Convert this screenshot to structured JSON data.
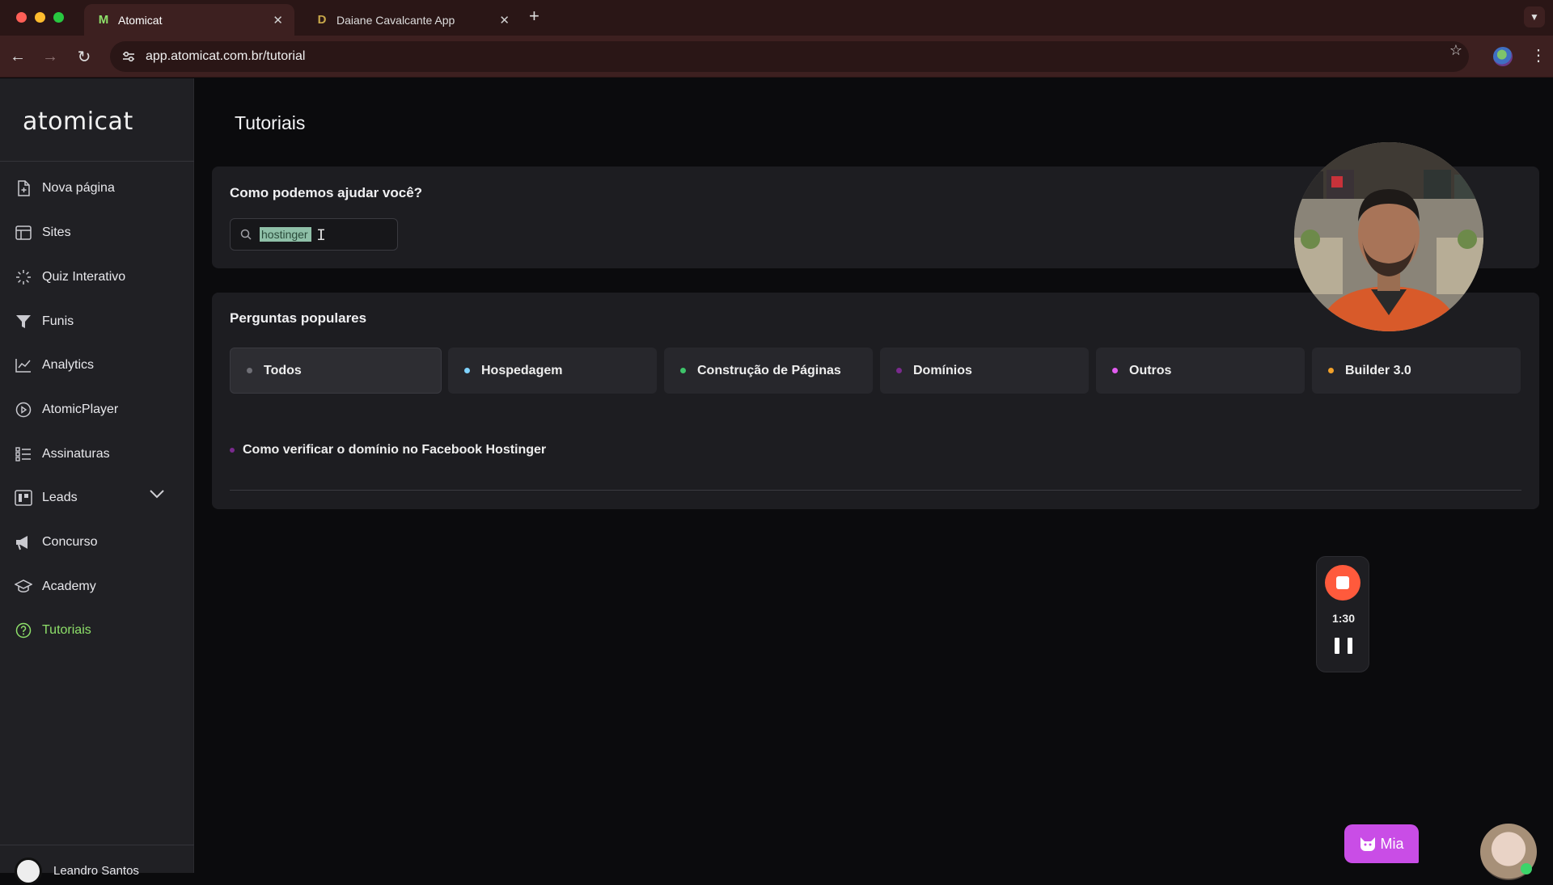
{
  "browser": {
    "tabs": [
      {
        "title": "Atomicat",
        "favicon": "M",
        "active": true
      },
      {
        "title": "Daiane Cavalcante App",
        "favicon": "D",
        "active": false
      }
    ],
    "url": "app.atomicat.com.br/tutorial"
  },
  "sidebar": {
    "logo": "atomicat",
    "items": [
      {
        "label": "Nova página",
        "icon": "new-page-icon"
      },
      {
        "label": "Sites",
        "icon": "sites-icon"
      },
      {
        "label": "Quiz Interativo",
        "icon": "quiz-icon"
      },
      {
        "label": "Funis",
        "icon": "funnel-icon"
      },
      {
        "label": "Analytics",
        "icon": "analytics-icon"
      },
      {
        "label": "AtomicPlayer",
        "icon": "player-icon"
      },
      {
        "label": "Assinaturas",
        "icon": "subscriptions-icon"
      },
      {
        "label": "Leads",
        "icon": "leads-icon"
      },
      {
        "label": "Concurso",
        "icon": "megaphone-icon"
      },
      {
        "label": "Academy",
        "icon": "academy-icon"
      },
      {
        "label": "Tutoriais",
        "icon": "help-icon",
        "active": true
      }
    ],
    "user_name": "Leandro Santos"
  },
  "main": {
    "page_title": "Tutoriais",
    "help_question": "Como podemos ajudar você?",
    "search_value": "hostinger",
    "popular_title": "Perguntas populares",
    "categories": [
      {
        "label": "Todos",
        "color": "#6f6f76",
        "selected": true
      },
      {
        "label": "Hospedagem",
        "color": "#7fd3ff"
      },
      {
        "label": "Construção de Páginas",
        "color": "#3ec46a"
      },
      {
        "label": "Domínios",
        "color": "#7a2a8e"
      },
      {
        "label": "Outros",
        "color": "#e25cf0"
      },
      {
        "label": "Builder 3.0",
        "color": "#f2a12a"
      }
    ],
    "questions": [
      {
        "label": "Como verificar o domínio no Facebook Hostinger",
        "color": "#7a2a8e"
      }
    ]
  },
  "recorder": {
    "time": "1:30"
  },
  "chat": {
    "label": "Mia"
  },
  "colors": {
    "accent": "#8ee06a",
    "record": "#ff5a3c",
    "chat": "#c94de6"
  }
}
